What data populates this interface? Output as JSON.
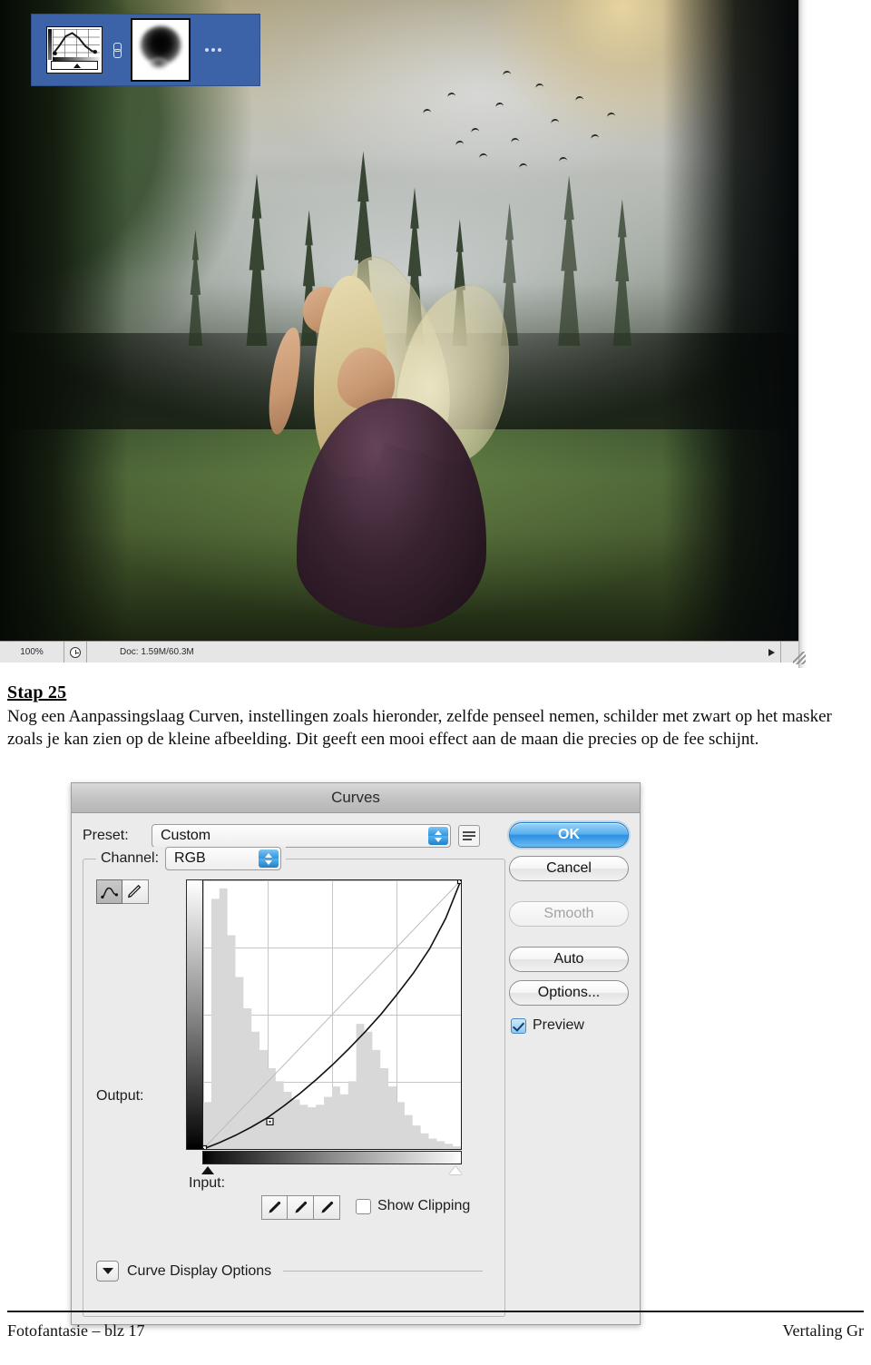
{
  "photoshop": {
    "status_bar": {
      "zoom": "100%",
      "doc_info": "Doc: 1.59M/60.3M",
      "clock_icon": "clock-icon",
      "arrow_icon": "triangle-right-icon"
    },
    "layers_snippet": {
      "adjustment_thumbnail_icon": "curves-adjustment-thumbnail-icon",
      "link_icon": "layer-link-icon",
      "mask_thumbnail_icon": "layer-mask-thumbnail-icon",
      "overflow_icon": "more-dots-icon"
    },
    "canvas_description": "misty forest scene with moon, flock of birds and a seated fairy"
  },
  "document": {
    "step_title": "Stap 25",
    "step_body": "Nog een Aanpassingslaag Curven, instellingen zoals hieronder, zelfde penseel nemen, schilder met zwart op het masker zoals je kan zien op de kleine afbeelding. Dit geeft een mooi effect aan de maan die precies op de fee schijnt.",
    "footer_left": "Fotofantasie – blz 17",
    "footer_right": "Vertaling Gr"
  },
  "curves_dialog": {
    "title": "Curves",
    "preset_label": "Preset:",
    "preset_value": "Custom",
    "preset_menu_icon": "preset-menu-icon",
    "channel_label": "Channel:",
    "channel_value": "RGB",
    "output_label": "Output:",
    "input_label": "Input:",
    "show_clipping_label": "Show Clipping",
    "show_clipping_checked": false,
    "preview_label": "Preview",
    "preview_checked": true,
    "curve_display_options_label": "Curve Display Options",
    "tools": [
      {
        "name": "curve-tool-icon",
        "active": true
      },
      {
        "name": "pencil-tool-icon",
        "active": false
      }
    ],
    "eyedroppers": [
      "black-point-eyedropper-icon",
      "gray-point-eyedropper-icon",
      "white-point-eyedropper-icon"
    ],
    "buttons": [
      {
        "label": "OK",
        "style": "primary"
      },
      {
        "label": "Cancel",
        "style": "normal"
      },
      {
        "label": "Smooth",
        "style": "disabled"
      },
      {
        "label": "Auto",
        "style": "normal"
      },
      {
        "label": "Options...",
        "style": "normal"
      }
    ],
    "accent_color": "#2d8fe2",
    "dialog_bg_color": "#ebebeb"
  },
  "chart_data": {
    "type": "line",
    "title": "Curves — RGB channel tone curve",
    "xlabel": "Input",
    "ylabel": "Output",
    "xlim": [
      0,
      255
    ],
    "ylim": [
      0,
      255
    ],
    "grid": true,
    "legend": "none",
    "series": [
      {
        "name": "Tone curve",
        "points": [
          [
            0,
            0
          ],
          [
            16,
            6
          ],
          [
            32,
            13
          ],
          [
            48,
            21
          ],
          [
            64,
            30
          ],
          [
            80,
            41
          ],
          [
            96,
            53
          ],
          [
            112,
            66
          ],
          [
            128,
            80
          ],
          [
            144,
            95
          ],
          [
            160,
            111
          ],
          [
            176,
            128
          ],
          [
            192,
            147
          ],
          [
            208,
            167
          ],
          [
            224,
            190
          ],
          [
            240,
            219
          ],
          [
            255,
            255
          ]
        ],
        "control_points": [
          [
            0,
            0
          ],
          [
            66,
            26
          ],
          [
            255,
            255
          ]
        ]
      },
      {
        "name": "Baseline (identity)",
        "points": [
          [
            0,
            0
          ],
          [
            255,
            255
          ]
        ]
      }
    ],
    "histogram": {
      "name": "Input histogram",
      "bins": 32,
      "values": [
        18,
        96,
        100,
        82,
        66,
        54,
        45,
        38,
        31,
        26,
        22,
        19,
        17,
        16,
        17,
        20,
        24,
        21,
        26,
        48,
        45,
        38,
        31,
        24,
        18,
        13,
        9,
        6,
        4,
        3,
        2,
        1
      ]
    }
  }
}
